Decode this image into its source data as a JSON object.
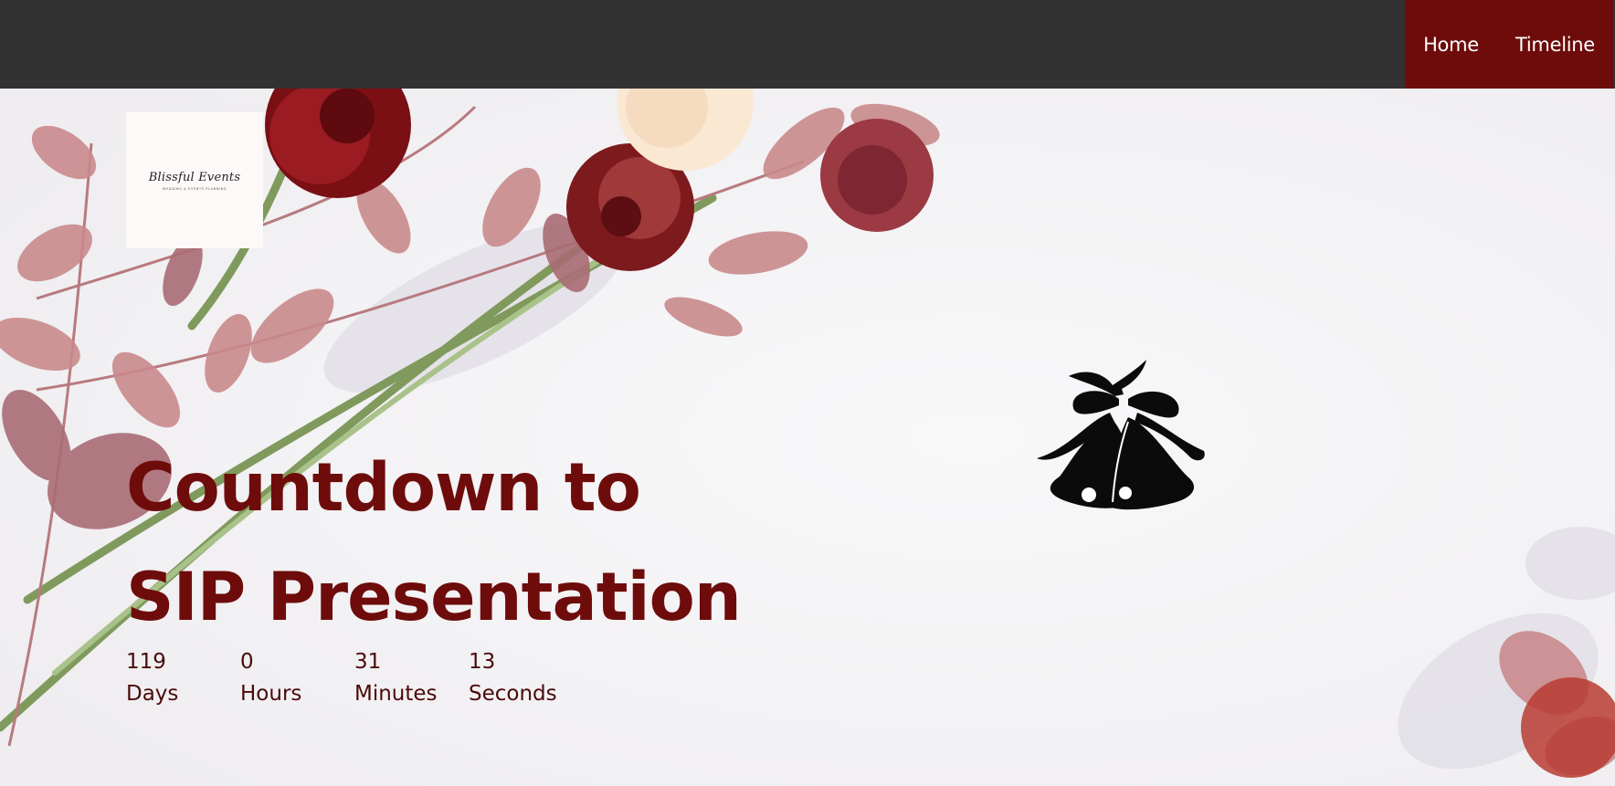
{
  "nav": {
    "home_label": "Home",
    "timeline_label": "Timeline"
  },
  "logo": {
    "name": "Blissful Events",
    "tagline": "WEDDING & EVENTS PLANNING"
  },
  "hero": {
    "title_line1": "Countdown to",
    "title_line2": "SIP Presentation"
  },
  "countdown": {
    "days": "119",
    "days_label": "Days",
    "hours": "0",
    "hours_label": "Hours",
    "minutes": "31",
    "minutes_label": "Minutes",
    "seconds": "13",
    "seconds_label": "Seconds"
  },
  "icons": {
    "bell": "wedding-bells-icon"
  },
  "colors": {
    "topbar": "#323232",
    "accent": "#6e0c0c",
    "background": "#f6f5f6",
    "text_dark_red": "#4a0a0a"
  }
}
